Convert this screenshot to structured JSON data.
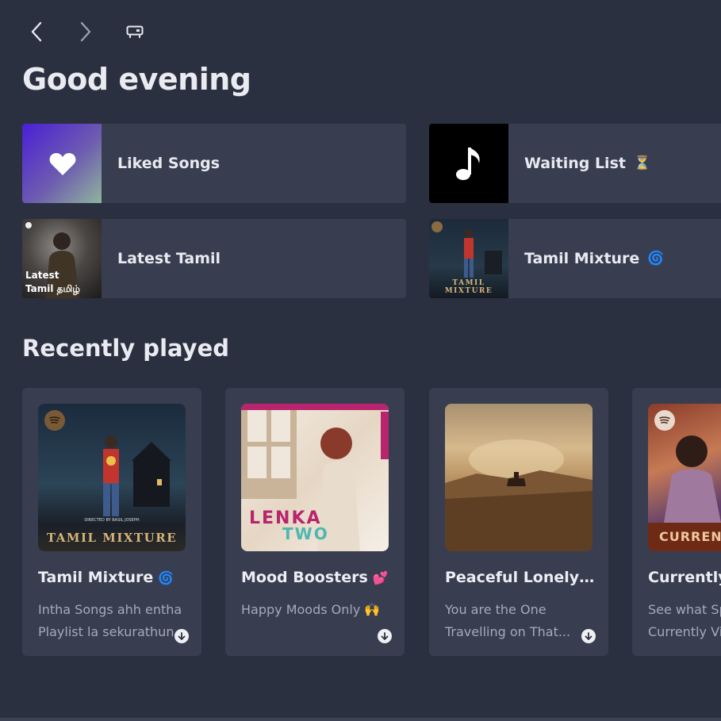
{
  "nav": {
    "back_icon": "chevron-left-icon",
    "forward_icon": "chevron-right-icon",
    "device_icon": "devices-icon"
  },
  "header": {
    "greeting": "Good evening"
  },
  "quick_tiles": [
    {
      "label": "Liked Songs",
      "emoji": "",
      "art": "heart-icon"
    },
    {
      "label": "Waiting List",
      "emoji": "⏳",
      "art": "music-note-icon"
    },
    {
      "label": "Latest Tamil",
      "emoji": "",
      "art_text": [
        "Latest",
        "Tamil தமிழ்"
      ]
    },
    {
      "label": "Tamil Mixture",
      "emoji": "🌀",
      "art_text": [
        "TAMIL MIXTURE"
      ]
    }
  ],
  "recently_played": {
    "title": "Recently played",
    "cards": [
      {
        "title": "Tamil Mixture",
        "emoji": "🌀",
        "desc": [
          "Intha Songs ahh entha",
          "Playlist la sekurathun"
        ],
        "art_text": "TAMIL MIXTURE",
        "art_small": "DIRECTED BY BASIL JOSEPH"
      },
      {
        "title": "Mood Boosters",
        "emoji": "💕",
        "desc": [
          "Happy Moods Only 🙌"
        ],
        "art_text": "LENKA",
        "art_text2": "TWO"
      },
      {
        "title": "Peaceful Lonely M...",
        "emoji": "",
        "desc": [
          "You are the One",
          "Travelling on That..."
        ]
      },
      {
        "title": "Currently",
        "emoji": "",
        "desc": [
          "See what Sp",
          "Currently Vi"
        ],
        "art_text": "CURRENTL"
      }
    ]
  },
  "colors": {
    "background": "#2b3040",
    "tile": "#383d50",
    "text_secondary": "#a5aabb"
  }
}
